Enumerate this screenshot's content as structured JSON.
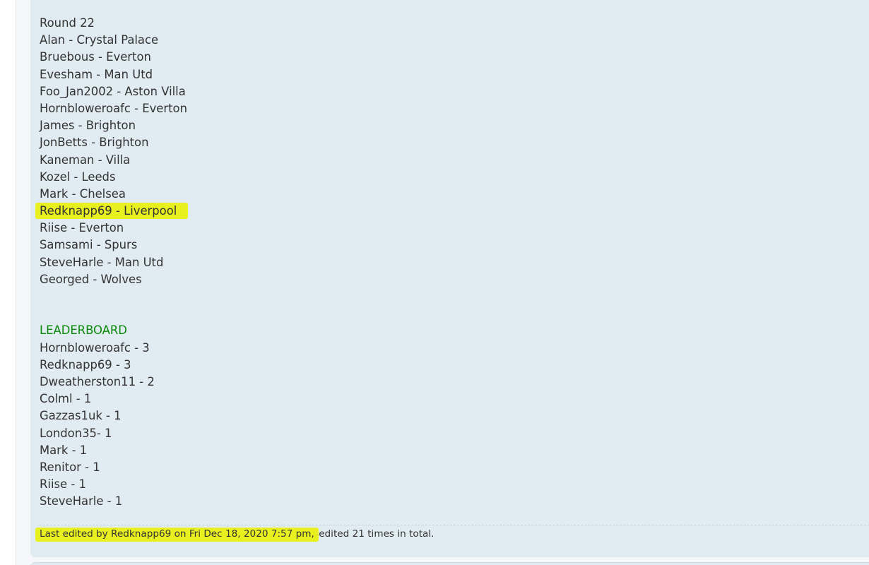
{
  "post": {
    "round_title": "Round 22",
    "picks": [
      "Alan - Crystal Palace",
      "Bruebous - Everton",
      "Evesham - Man Utd",
      "Foo_Jan2002 - Aston Villa",
      "Hornbloweroafc - Everton",
      "James - Brighton",
      "JonBetts - Brighton",
      "Kaneman - Villa",
      "Kozel - Leeds",
      "Mark - Chelsea",
      "Redknapp69 - Liverpool",
      "Riise - Everton",
      "Samsami - Spurs",
      "SteveHarle - Man Utd",
      "Georged - Wolves"
    ],
    "leaderboard_title": "LEADERBOARD",
    "leaderboard": [
      "Hornbloweroafc - 3",
      "Redknapp69 - 3",
      "Dweatherston11 - 2",
      "Colml - 1",
      "Gazzas1uk - 1",
      "London35- 1",
      "Mark - 1",
      "Renitor - 1",
      "Riise - 1",
      "SteveHarle - 1"
    ]
  },
  "edit_note": {
    "highlighted_part": "Last edited by Redknapp69 on Fri Dec 18, 2020 7:57 pm, ",
    "rest": "edited 21 times in total."
  },
  "colors": {
    "post_background": "#e1ebf2",
    "highlight": "#e9f020",
    "leaderboard_title": "#0a8a0a",
    "text": "#333333"
  }
}
